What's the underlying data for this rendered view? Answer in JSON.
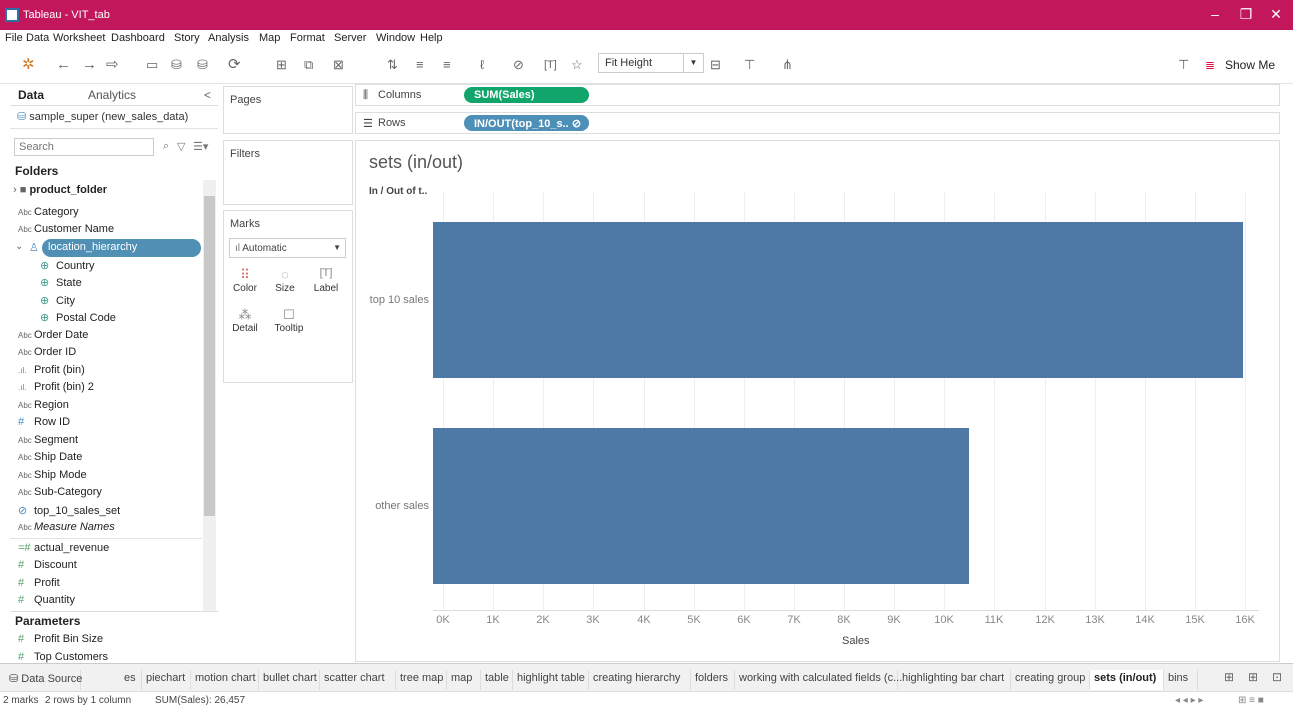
{
  "window": {
    "title": "Tableau - VIT_tab",
    "minimize": "–",
    "restore": "❐",
    "close": "✕"
  },
  "menu": [
    "File",
    "Data",
    "Worksheet",
    "Dashboard",
    "Story",
    "Analysis",
    "Map",
    "Format",
    "Server",
    "Window",
    "Help"
  ],
  "toolbar": {
    "fit_value": "Fit Height",
    "show_me_label": "Show Me"
  },
  "left_pane": {
    "tab_data": "Data",
    "tab_analytics": "Analytics",
    "collapse": "<",
    "data_source": "sample_super (new_sales_data)",
    "search_placeholder": "Search",
    "folders_header": "Folders",
    "product_folder": "product_folder",
    "dimensions": [
      {
        "icon": "Abc",
        "label": "Category"
      },
      {
        "icon": "Abc",
        "label": "Customer Name"
      }
    ],
    "hierarchy_label": "location_hierarchy",
    "hierarchy_children": [
      "Country",
      "State",
      "City",
      "Postal Code"
    ],
    "more_fields": [
      {
        "icon": "Abc",
        "label": "Order Date"
      },
      {
        "icon": "Abc",
        "label": "Order ID"
      },
      {
        "icon": ".ıl.",
        "label": "Profit (bin)"
      },
      {
        "icon": ".ıl.",
        "label": "Profit (bin) 2"
      },
      {
        "icon": "Abc",
        "label": "Region"
      },
      {
        "icon": "#",
        "label": "Row ID"
      },
      {
        "icon": "Abc",
        "label": "Segment"
      },
      {
        "icon": "Abc",
        "label": "Ship Date"
      },
      {
        "icon": "Abc",
        "label": "Ship Mode"
      },
      {
        "icon": "Abc",
        "label": "Sub-Category"
      },
      {
        "icon": "⊘",
        "label": "top_10_sales_set"
      },
      {
        "icon": "Abc",
        "label": "Measure Names"
      },
      {
        "icon": "=#",
        "label": "actual_revenue"
      },
      {
        "icon": "#",
        "label": "Discount"
      },
      {
        "icon": "#",
        "label": "Profit"
      },
      {
        "icon": "#",
        "label": "Quantity"
      }
    ],
    "parameters_header": "Parameters",
    "parameters": [
      "Profit Bin Size",
      "Top Customers"
    ]
  },
  "cards": {
    "pages": "Pages",
    "filters": "Filters",
    "marks": "Marks",
    "mark_type": "Automatic",
    "mark_buttons": [
      "Color",
      "Size",
      "Label",
      "Detail",
      "Tooltip"
    ]
  },
  "shelves": {
    "columns_label": "Columns",
    "columns_pill": "SUM(Sales)",
    "rows_label": "Rows",
    "rows_pill": "IN/OUT(top_10_s..",
    "rows_pill_icon": "⊘"
  },
  "view": {
    "title": "sets (in/out)",
    "row_header": "In / Out of t.."
  },
  "chart_data": {
    "type": "bar",
    "orientation": "horizontal",
    "categories": [
      "top 10 sales",
      "other sales"
    ],
    "values": [
      15960,
      10497
    ],
    "xlabel": "Sales",
    "ylabel": "In / Out of t..",
    "xlim": [
      0,
      16500
    ],
    "x_ticks": [
      0,
      1000,
      2000,
      3000,
      4000,
      5000,
      6000,
      7000,
      8000,
      9000,
      10000,
      11000,
      12000,
      13000,
      14000,
      15000,
      16000
    ],
    "x_tick_labels": [
      "0K",
      "1K",
      "2K",
      "3K",
      "4K",
      "5K",
      "6K",
      "7K",
      "8K",
      "9K",
      "10K",
      "11K",
      "12K",
      "13K",
      "14K",
      "15K",
      "16K"
    ],
    "bar_color": "#4e79a7",
    "grid": true
  },
  "sheet_tabs": {
    "data_source": "Data Source",
    "tabs": [
      "es",
      "piechart",
      "motion chart",
      "bullet chart",
      "scatter chart",
      "tree map",
      "map",
      "table",
      "highlight table",
      "creating hierarchy",
      "folders",
      "working with calculated fields (c...",
      "highlighting bar chart",
      "creating group",
      "sets (in/out)",
      "bins"
    ],
    "active": "sets (in/out)"
  },
  "status": {
    "marks": "2 marks",
    "rows": "2 rows by 1 column",
    "sum": "SUM(Sales): 26,457"
  },
  "colors": {
    "title_bar": "#c2185b",
    "columns_pill": "#12a56b",
    "rows_pill": "#4e8fb8",
    "bar": "#4e79a7"
  }
}
